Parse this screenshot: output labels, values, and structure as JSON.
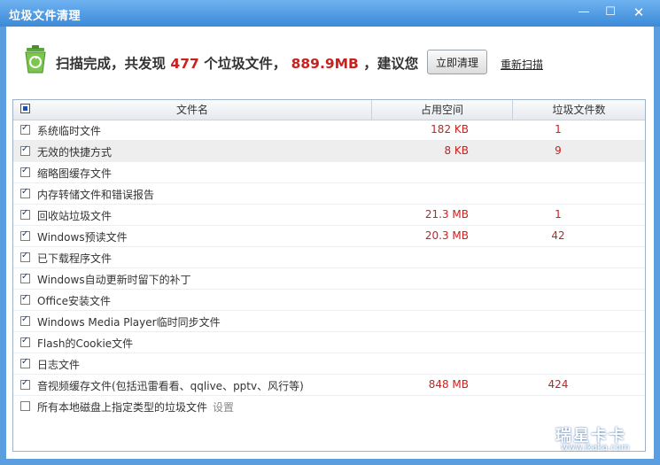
{
  "window": {
    "title": "垃圾文件清理",
    "min_glyph": "—",
    "max_glyph": "☐",
    "close_glyph": "✕"
  },
  "summary": {
    "prefix": "扫描完成，共发现",
    "count": "477",
    "mid": "个垃圾文件，",
    "size": "889.9MB",
    "suffix": "，建议您"
  },
  "actions": {
    "clean_label": "立即清理",
    "rescan_label": "重新扫描"
  },
  "table": {
    "columns": [
      "文件名",
      "占用空间",
      "垃圾文件数"
    ],
    "rows": [
      {
        "name": "系统临时文件",
        "size": "182 KB",
        "count": "1"
      },
      {
        "name": "无效的快捷方式",
        "size": "8 KB",
        "count": "9"
      },
      {
        "name": "缩略图缓存文件",
        "size": "",
        "count": ""
      },
      {
        "name": "内存转储文件和错误报告",
        "size": "",
        "count": ""
      },
      {
        "name": "回收站垃圾文件",
        "size": "21.3 MB",
        "count": "1"
      },
      {
        "name": "Windows预读文件",
        "size": "20.3 MB",
        "count": "42"
      },
      {
        "name": "已下载程序文件",
        "size": "",
        "count": ""
      },
      {
        "name": "Windows自动更新时留下的补丁",
        "size": "",
        "count": ""
      },
      {
        "name": "Office安装文件",
        "size": "",
        "count": ""
      },
      {
        "name": "Windows Media Player临时同步文件",
        "size": "",
        "count": ""
      },
      {
        "name": "Flash的Cookie文件",
        "size": "",
        "count": ""
      },
      {
        "name": "日志文件",
        "size": "",
        "count": ""
      },
      {
        "name": "音视频缓存文件(包括迅雷看看、qqlive、pptv、风行等)",
        "size": "848 MB",
        "count": "424"
      }
    ],
    "last_row": {
      "name": "所有本地磁盘上指定类型的垃圾文件",
      "settings": "设置"
    }
  },
  "watermark": {
    "brand": "瑞星卡卡",
    "url": "www.ikaka.com"
  },
  "colors": {
    "accent": "#3b8ad8",
    "highlight": "#c9211f"
  }
}
